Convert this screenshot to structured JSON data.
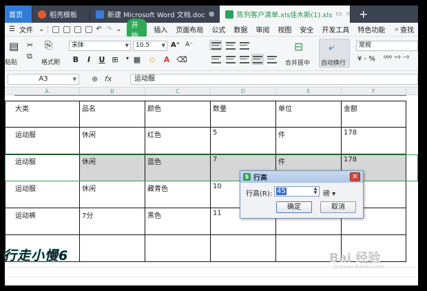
{
  "tabs": [
    {
      "label": "首页",
      "active": false
    },
    {
      "label": "稻壳模板",
      "active": false
    },
    {
      "label": "新建 Microsoft Word 文档.doc",
      "active": false
    },
    {
      "label": "陈列客户清单.xls佳木斯(1).xls",
      "active": true
    }
  ],
  "tabs_plus": "+",
  "menu": {
    "file": "文件",
    "start": "开始",
    "items": [
      "插入",
      "页面布局",
      "公式",
      "数据",
      "审阅",
      "视图",
      "安全",
      "开发工具",
      "特色功能"
    ],
    "search": "查找"
  },
  "ribbon": {
    "paste": "粘贴",
    "format_painter": "格式刷",
    "font_name": "宋体",
    "font_size": "10.5",
    "merge_center": "合并居中",
    "wrap_text": "自动换行",
    "number_format": "常规"
  },
  "formula_bar": {
    "name_box": "A3",
    "fx": "fx",
    "value": "运动服"
  },
  "columns": [
    "A",
    "B",
    "C",
    "D",
    "E",
    "F"
  ],
  "table": [
    [
      "大类",
      "品名",
      "颜色",
      "数量",
      "单位",
      "金额"
    ],
    [
      "运动服",
      "休闲",
      "红色",
      "5",
      "件",
      "178"
    ],
    [
      "运动服",
      "休闲",
      "蓝色",
      "7",
      "件",
      "178"
    ],
    [
      "运动服",
      "休闲",
      "藏青色",
      "10",
      "",
      ""
    ],
    [
      "运动裤",
      "7分",
      "黑色",
      "11",
      "",
      ""
    ],
    [
      "",
      "",
      "",
      "",
      "",
      ""
    ]
  ],
  "dialog": {
    "title": "行高",
    "label": "行高(R):",
    "value": "45",
    "unit": "磅",
    "ok": "确定",
    "cancel": "取消",
    "close": "✕"
  },
  "overlay_text": "行走小慢6",
  "watermark": "Bai 经验",
  "watermark_sub": "jingyan.baidu.com",
  "colors": {
    "accent_green": "#2ea04f",
    "tab_bar": "#3c4350",
    "selected_row_fill": "#d6d6d6"
  }
}
